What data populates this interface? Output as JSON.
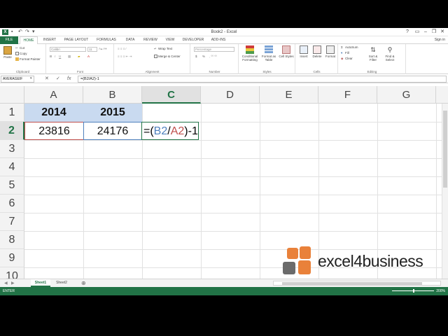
{
  "titlebar": {
    "app_icon": "X",
    "title": "Book2 - Excel",
    "help": "?",
    "minimize": "–",
    "restore": "❐",
    "close": "✕"
  },
  "tabs": [
    "FILE",
    "HOME",
    "INSERT",
    "PAGE LAYOUT",
    "FORMULAS",
    "DATA",
    "REVIEW",
    "VIEW",
    "DEVELOPER",
    "ADD-INS"
  ],
  "signin": "Sign in",
  "ribbon": {
    "clipboard": {
      "label": "Clipboard",
      "paste": "Paste",
      "cut": "Cut",
      "copy": "Copy",
      "format_painter": "Format Painter"
    },
    "font": {
      "label": "Font",
      "font_name": "Calibri",
      "font_size": "11"
    },
    "alignment": {
      "label": "Alignment",
      "wrap": "Wrap Text",
      "merge": "Merge & Center"
    },
    "number": {
      "label": "Number",
      "format": "Percentage",
      "currency": "$",
      "percent": "%"
    },
    "styles": {
      "label": "Styles",
      "conditional": "Conditional Formatting",
      "table": "Format as Table",
      "cell": "Cell Styles"
    },
    "cells": {
      "label": "Cells",
      "insert": "Insert",
      "delete": "Delete",
      "format": "Format"
    },
    "editing": {
      "label": "Editing",
      "autosum": "AutoSum",
      "fill": "Fill",
      "clear": "Clear",
      "sort": "Sort & Filter",
      "find": "Find & Select"
    }
  },
  "formula_bar": {
    "namebox": "AVERAGEIF",
    "cancel": "✕",
    "enter": "✓",
    "fx": "fx",
    "formula": "=(B2/A2)-1"
  },
  "columns": [
    "A",
    "B",
    "C",
    "D",
    "E",
    "F",
    "G"
  ],
  "rows": [
    "1",
    "2",
    "3",
    "4",
    "5",
    "6",
    "7",
    "8",
    "9",
    "10"
  ],
  "cells": {
    "A1": "2014",
    "B1": "2015",
    "A2": "23816",
    "B2": "24176",
    "C2_parts": [
      "=(",
      "B2",
      "/",
      "A2",
      ")-1"
    ]
  },
  "logo": {
    "brand": "excel4business",
    "colors": [
      "#e9813a",
      "#6b6b6b",
      "#e9813a",
      "#6b6b6b"
    ]
  },
  "sheets": [
    "Sheet1",
    "Sheet2"
  ],
  "add_sheet": "⊕",
  "status": {
    "mode": "ENTER",
    "zoom": "200%"
  },
  "colors": {
    "accent": "#217346",
    "header_fill": "#c9daf0",
    "ref_blue": "#4f81bd",
    "ref_red": "#c0504d"
  }
}
